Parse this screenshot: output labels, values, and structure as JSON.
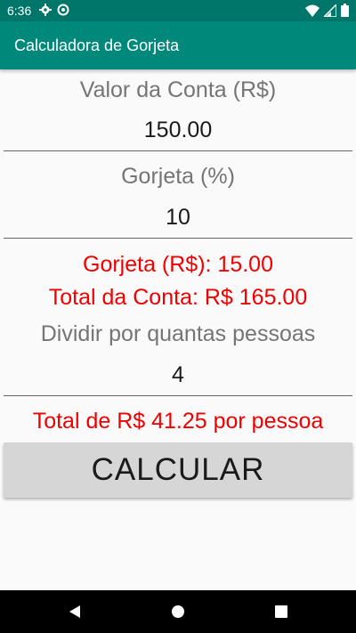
{
  "status_bar": {
    "time": "6:36",
    "icons": [
      "gear-icon",
      "sync-icon",
      "wifi-icon",
      "signal-icon",
      "battery-icon"
    ]
  },
  "app_bar": {
    "title": "Calculadora de Gorjeta",
    "color": "#00897b",
    "status_color": "#00766b"
  },
  "form": {
    "bill_label": "Valor da Conta (R$)",
    "bill_value": "150.00",
    "tip_label": "Gorjeta (%)",
    "tip_value": "10",
    "tip_result": "Gorjeta (R$): 15.00",
    "total_result": "Total da Conta: R$ 165.00",
    "split_label": "Dividir por quantas pessoas",
    "split_value": "4",
    "per_person_result": "Total de R$ 41.25 por pessoa"
  },
  "actions": {
    "calculate_label": "CALCULAR"
  },
  "nav_bar": {
    "icons": [
      "back-icon",
      "home-icon",
      "recents-icon"
    ]
  },
  "colors": {
    "result_text": "#f00000",
    "label_text": "#757575",
    "button_bg": "#d6d6d6"
  }
}
